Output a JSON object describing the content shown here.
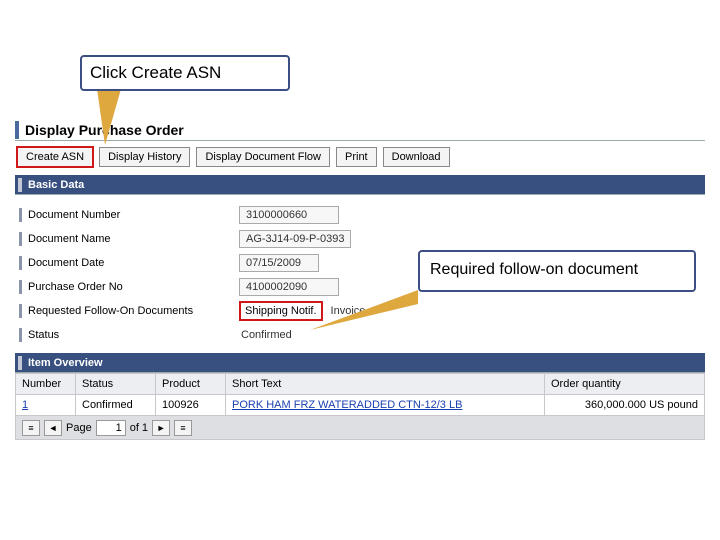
{
  "callouts": {
    "c1": "Click Create ASN",
    "c2": "Required follow-on document"
  },
  "header": {
    "title": "Display Purchase Order"
  },
  "buttons": {
    "create_asn": "Create ASN",
    "display_history": "Display History",
    "display_doc_flow": "Display Document Flow",
    "print": "Print",
    "download": "Download"
  },
  "sections": {
    "basic": "Basic Data",
    "item_overview": "Item Overview"
  },
  "fields": {
    "doc_number": {
      "label": "Document Number",
      "value": "3100000660"
    },
    "doc_name": {
      "label": "Document Name",
      "value": "AG-3J14-09-P-0393"
    },
    "doc_date": {
      "label": "Document Date",
      "value": "07/15/2009"
    },
    "po_no": {
      "label": "Purchase Order No",
      "value": "4100002090"
    },
    "followon": {
      "label": "Requested Follow-On Documents",
      "value1": "Shipping Notif.",
      "value2": "Invoice"
    },
    "status": {
      "label": "Status",
      "value": "Confirmed"
    }
  },
  "table": {
    "cols": {
      "number": "Number",
      "status": "Status",
      "product": "Product",
      "short_text": "Short Text",
      "order_qty": "Order quantity"
    },
    "rows": [
      {
        "number": "1",
        "status": "Confirmed",
        "product": "100926",
        "short_text": "PORK HAM FRZ WATERADDED CTN-12/3 LB",
        "order_qty": "360,000.000 US pound"
      }
    ]
  },
  "pager": {
    "label_page": "Page",
    "current": "1",
    "of": "of 1"
  }
}
